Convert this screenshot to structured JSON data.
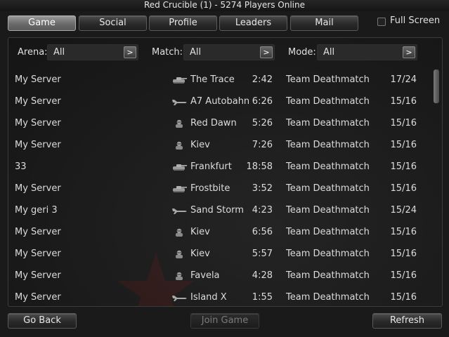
{
  "window": {
    "title": "Red Crucible (1) - 5274 Players Online"
  },
  "nav": {
    "tabs": [
      {
        "label": "Game",
        "active": true
      },
      {
        "label": "Social",
        "active": false
      },
      {
        "label": "Profile",
        "active": false
      },
      {
        "label": "Leaders",
        "active": false
      },
      {
        "label": "Mail",
        "active": false
      }
    ]
  },
  "fullscreen": {
    "label": "Full Screen",
    "checked": false
  },
  "filters": {
    "arena": {
      "label": "Arena:",
      "value": "All",
      "button": ">"
    },
    "match": {
      "label": "Match:",
      "value": "All",
      "button": ">"
    },
    "mode": {
      "label": "Mode:",
      "value": "All",
      "button": ">"
    }
  },
  "servers": [
    {
      "name": "My Server",
      "icon": "tank-icon",
      "map": "The Trace",
      "time": "2:42",
      "mode": "Team Deathmatch",
      "players": "17/24"
    },
    {
      "name": "My Server",
      "icon": "jet-icon",
      "map": "A7 Autobahn",
      "time": "6:26",
      "mode": "Team Deathmatch",
      "players": "15/16"
    },
    {
      "name": "My Server",
      "icon": "soldier-icon",
      "map": "Red Dawn",
      "time": "5:26",
      "mode": "Team Deathmatch",
      "players": "15/16"
    },
    {
      "name": "My Server",
      "icon": "soldier-icon",
      "map": "Kiev",
      "time": "7:26",
      "mode": "Team Deathmatch",
      "players": "15/16"
    },
    {
      "name": "33",
      "icon": "tank-icon",
      "map": "Frankfurt",
      "time": "18:58",
      "mode": "Team Deathmatch",
      "players": "15/16"
    },
    {
      "name": "My Server",
      "icon": "tank-icon",
      "map": "Frostbite",
      "time": "3:52",
      "mode": "Team Deathmatch",
      "players": "15/16"
    },
    {
      "name": "My geri 3",
      "icon": "jet-icon",
      "map": "Sand Storm",
      "time": "4:23",
      "mode": "Team Deathmatch",
      "players": "15/24"
    },
    {
      "name": "My Server",
      "icon": "soldier-icon",
      "map": "Kiev",
      "time": "6:56",
      "mode": "Team Deathmatch",
      "players": "15/16"
    },
    {
      "name": "My Server",
      "icon": "soldier-icon",
      "map": "Kiev",
      "time": "5:57",
      "mode": "Team Deathmatch",
      "players": "15/16"
    },
    {
      "name": "My Server",
      "icon": "soldier-icon",
      "map": "Favela",
      "time": "4:28",
      "mode": "Team Deathmatch",
      "players": "15/16"
    },
    {
      "name": "My Server",
      "icon": "jet-icon",
      "map": "Island X",
      "time": "1:55",
      "mode": "Team Deathmatch",
      "players": "15/16"
    }
  ],
  "footer": {
    "back_label": "Go Back",
    "join_label": "Join Game",
    "refresh_label": "Refresh"
  },
  "colors": {
    "watermark": "#8b1a1a",
    "active_tab": "#7a7a7a"
  }
}
